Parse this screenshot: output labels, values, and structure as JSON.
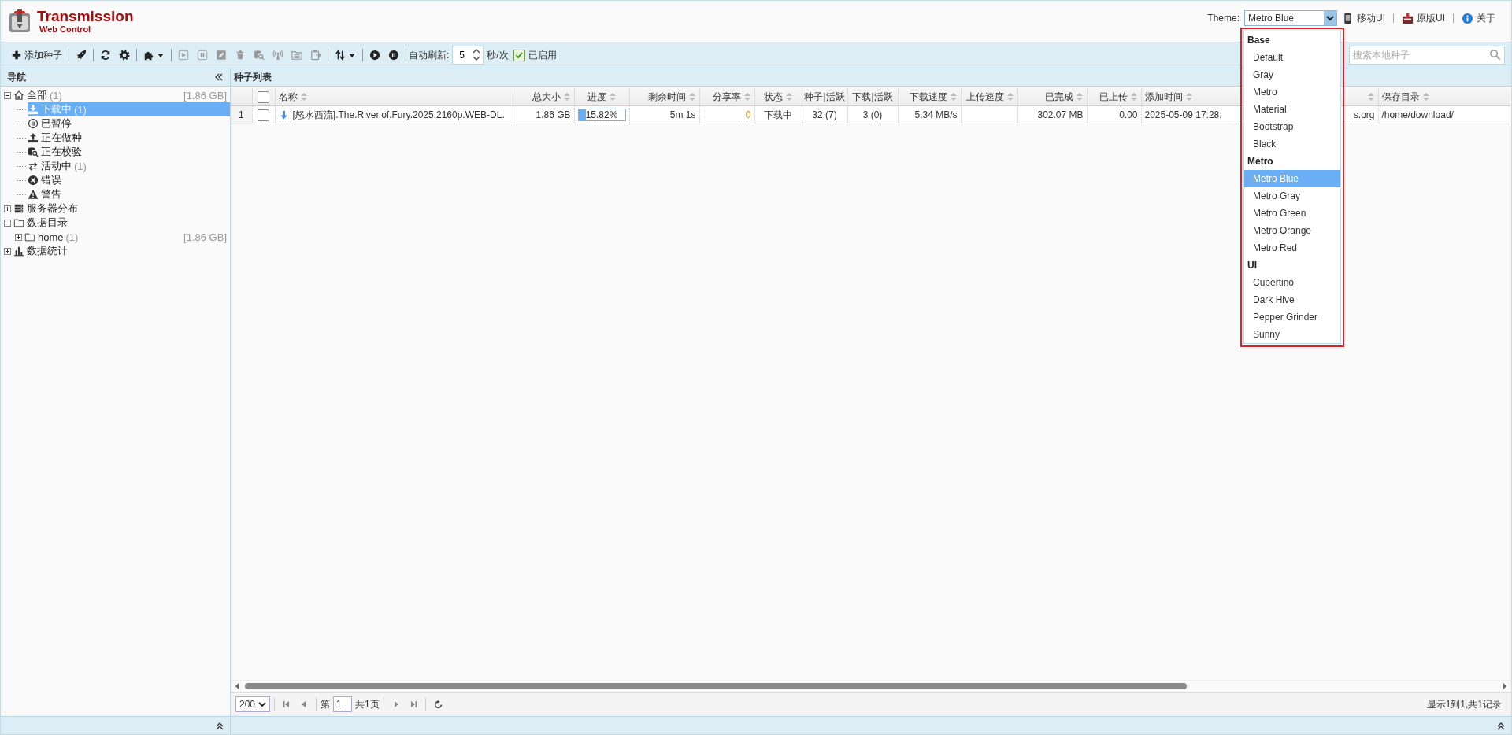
{
  "header": {
    "title": "Transmission",
    "subtitle": "Web Control",
    "theme_label": "Theme:",
    "theme_value": "Metro Blue",
    "links": [
      {
        "kind": "phone",
        "label": "移动UI"
      },
      {
        "kind": "classic",
        "label": "原版UI"
      },
      {
        "kind": "info",
        "label": "关于"
      }
    ]
  },
  "theme_menu": {
    "highlighted": true,
    "groups": [
      {
        "label": "Base",
        "options": [
          {
            "label": "Default",
            "selected": false
          },
          {
            "label": "Gray",
            "selected": false
          },
          {
            "label": "Metro",
            "selected": false
          },
          {
            "label": "Material",
            "selected": false
          },
          {
            "label": "Bootstrap",
            "selected": false
          },
          {
            "label": "Black",
            "selected": false
          }
        ]
      },
      {
        "label": "Metro",
        "options": [
          {
            "label": "Metro Blue",
            "selected": true
          },
          {
            "label": "Metro Gray",
            "selected": false
          },
          {
            "label": "Metro Green",
            "selected": false
          },
          {
            "label": "Metro Orange",
            "selected": false
          },
          {
            "label": "Metro Red",
            "selected": false
          }
        ]
      },
      {
        "label": "UI",
        "options": [
          {
            "label": "Cupertino",
            "selected": false
          },
          {
            "label": "Dark Hive",
            "selected": false
          },
          {
            "label": "Pepper Grinder",
            "selected": false
          },
          {
            "label": "Sunny",
            "selected": false
          }
        ]
      }
    ]
  },
  "toolbar": {
    "groups": [
      [
        {
          "kind": "add",
          "label": "添加种子",
          "disabled": false,
          "menu": false
        }
      ],
      [
        {
          "kind": "rocket",
          "disabled": false,
          "menu": false
        }
      ],
      [
        {
          "kind": "refresh",
          "disabled": false,
          "menu": false
        },
        {
          "kind": "gear",
          "disabled": false,
          "menu": false
        }
      ],
      [
        {
          "kind": "puzzle",
          "disabled": false,
          "menu": true
        }
      ],
      [
        {
          "kind": "start",
          "disabled": true,
          "menu": false
        },
        {
          "kind": "pause",
          "disabled": true,
          "menu": false
        },
        {
          "kind": "rename",
          "disabled": true,
          "menu": false
        },
        {
          "kind": "remove",
          "disabled": true,
          "menu": false
        },
        {
          "kind": "verify",
          "disabled": true,
          "menu": false
        },
        {
          "kind": "reannounce",
          "disabled": true,
          "menu": false
        },
        {
          "kind": "move",
          "disabled": true,
          "menu": false
        },
        {
          "kind": "copy",
          "disabled": true,
          "menu": false
        }
      ],
      [
        {
          "kind": "sort",
          "disabled": false,
          "menu": true
        }
      ],
      [
        {
          "kind": "play-all",
          "disabled": false,
          "menu": false
        },
        {
          "kind": "pause-all",
          "disabled": false,
          "menu": false
        }
      ]
    ],
    "auto_refresh": {
      "label": "自动刷新:",
      "value": "5",
      "unit": "秒/次",
      "enabled_label": "已启用",
      "checked": true
    },
    "search": {
      "placeholder": "搜索本地种子"
    }
  },
  "sidebar": {
    "title": "导航",
    "tree": [
      {
        "kind": "home",
        "label": "全部",
        "count": "(1)",
        "size": "[1.86 GB]",
        "expanded": true,
        "selected": false,
        "children": [
          {
            "kind": "download",
            "label": "下载中",
            "count": "(1)",
            "selected": true
          },
          {
            "kind": "paused",
            "label": "已暂停",
            "selected": false
          },
          {
            "kind": "upload",
            "label": "正在做种",
            "selected": false
          },
          {
            "kind": "verify",
            "label": "正在校验",
            "selected": false
          },
          {
            "kind": "transfer",
            "label": "活动中",
            "count": "(1)",
            "selected": false
          },
          {
            "kind": "error",
            "label": "错误",
            "selected": false
          },
          {
            "kind": "warning",
            "label": "警告",
            "selected": false
          }
        ]
      },
      {
        "kind": "server",
        "label": "服务器分布",
        "expanded": false,
        "selected": false
      },
      {
        "kind": "folder",
        "label": "数据目录",
        "expanded": true,
        "selected": false,
        "children": [
          {
            "kind": "folder",
            "label": "home",
            "count": "(1)",
            "size": "[1.86 GB]",
            "expanded": false,
            "selected": false
          }
        ]
      },
      {
        "kind": "chart",
        "label": "数据统计",
        "expanded": false,
        "selected": false
      }
    ]
  },
  "table": {
    "title": "种子列表",
    "columns": [
      {
        "kind": "number"
      },
      {
        "kind": "checkbox",
        "checked": false
      },
      {
        "kind": "name",
        "label": "名称",
        "sortable": true
      },
      {
        "kind": "text",
        "label": "总大小",
        "sortable": true
      },
      {
        "kind": "text",
        "label": "进度",
        "sortable": true
      },
      {
        "kind": "text",
        "label": "剩余时间",
        "sortable": true
      },
      {
        "kind": "ratio",
        "label": "分享率",
        "sortable": true
      },
      {
        "kind": "text",
        "label": "状态",
        "sortable": true
      },
      {
        "kind": "text",
        "label": "种子|活跃",
        "sortable": false
      },
      {
        "kind": "text",
        "label": "下载|活跃",
        "sortable": false
      },
      {
        "kind": "text",
        "label": "下载速度",
        "sortable": true
      },
      {
        "kind": "text",
        "label": "上传速度",
        "sortable": true
      },
      {
        "kind": "text",
        "label": "已完成",
        "sortable": true
      },
      {
        "kind": "text",
        "label": "已上传",
        "sortable": true
      },
      {
        "kind": "text",
        "label": "添加时间",
        "sortable": true
      },
      {
        "kind": "text",
        "sortable": true
      },
      {
        "kind": "text",
        "label": "保存目录",
        "sortable": true
      }
    ],
    "rows": [
      {
        "kind": "downloading",
        "cells": [
          "1",
          {
            "kind": "checkbox",
            "checked": false
          },
          "[怒水西流].The.River.of.Fury.2025.2160p.WEB-DL.",
          "1.86 GB",
          {
            "kind": "progress",
            "level": 0.1582,
            "text": "15.82%"
          },
          "5m 1s",
          "0",
          "下载中",
          "32 (7)",
          "3 (0)",
          "5.34 MB/s",
          null,
          "302.07 MB",
          "0.00",
          "2025-05-09 17:28:",
          "s.org",
          "/home/download/"
        ]
      }
    ]
  },
  "pager": {
    "page_size": "200",
    "page_prefix": "第",
    "page": "1",
    "page_total": "共1页",
    "record_info": "显示1到1,共1记录"
  }
}
